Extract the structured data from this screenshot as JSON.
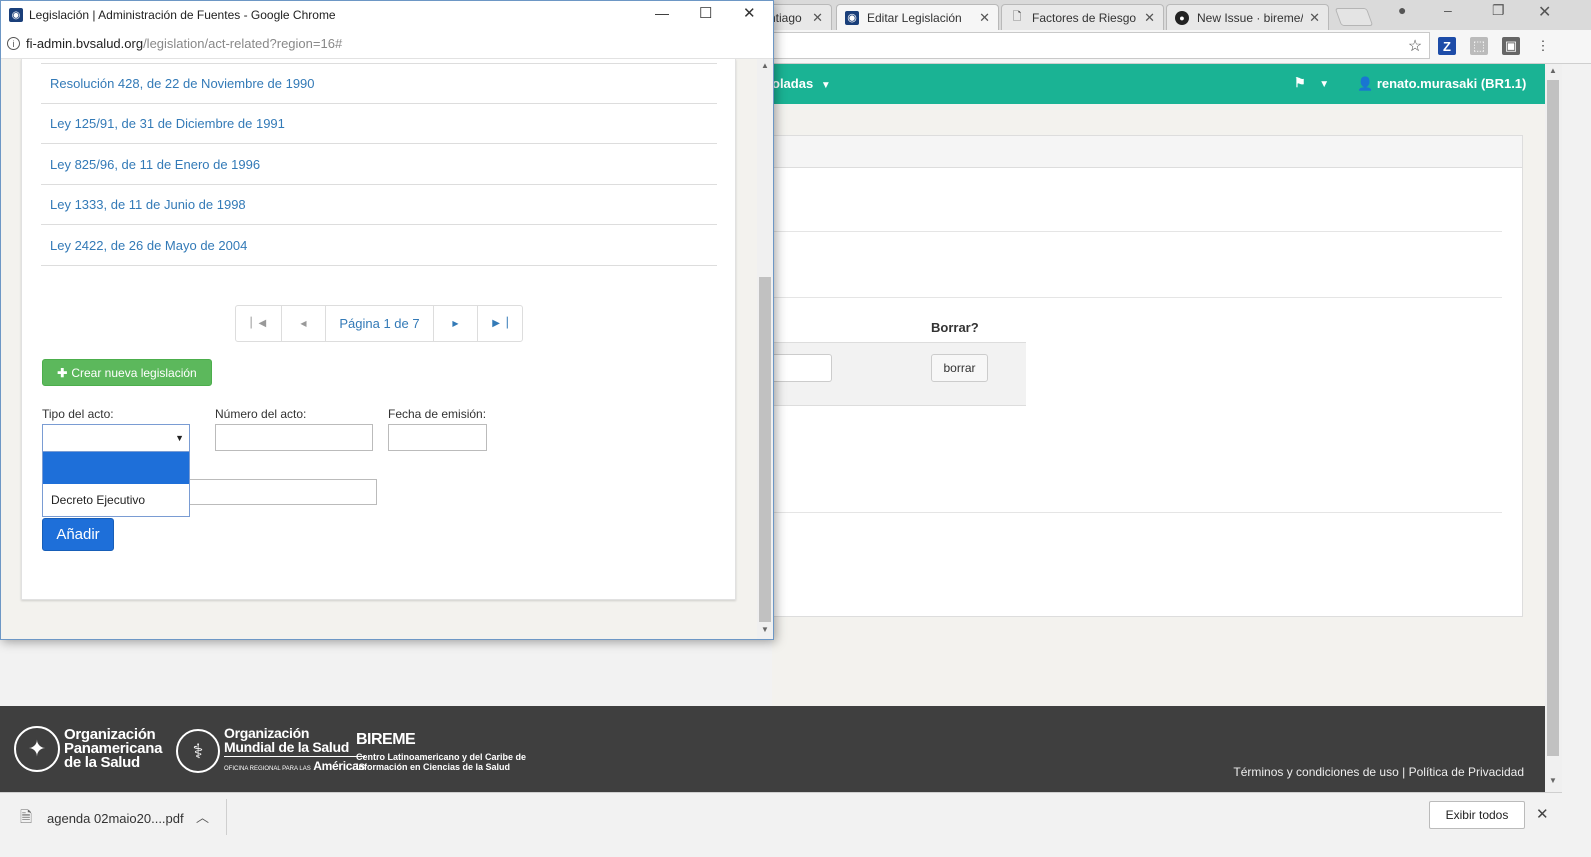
{
  "background_window": {
    "tabs": [
      {
        "title": "ntiago",
        "icon": "page-icon"
      },
      {
        "title": "Editar Legislación",
        "icon": "bireme-icon"
      },
      {
        "title": "Factores de Riesgo",
        "icon": "document-icon"
      },
      {
        "title": "New Issue · bireme/",
        "icon": "github-icon"
      }
    ],
    "navbar": {
      "menu_label": "oladas",
      "user_label": "renato.murasaki (BR1.1)"
    },
    "table": {
      "delete_header": "Borrar?",
      "delete_button": "borrar"
    },
    "footer": {
      "paho_name": "Organización Panamericana de la Salud",
      "paho_line1": "Organización",
      "paho_line2": "Panamericana",
      "paho_line3": "de la Salud",
      "who_line1": "Organización",
      "who_line2": "Mundial de la Salud",
      "who_regional": "OFICINA REGIONAL PARA LAS",
      "who_region": "Américas",
      "bireme_title": "BIREME",
      "bireme_line1": "Centro Latinoamericano y del Caribe de",
      "bireme_line2": "Información en Ciencias de la Salud",
      "terms": "Términos y condiciones de uso",
      "separator": "|",
      "privacy": "Política de Privacidad"
    },
    "download_bar": {
      "filename": "agenda 02maio20....pdf",
      "show_all": "Exibir todos"
    }
  },
  "popup": {
    "window_title": "Legislación | Administración de Fuentes - Google Chrome",
    "url_host": "fi-admin.bvsalud.org",
    "url_path": "/legislation/act-related?region=16#",
    "laws": [
      "Resolución 428, de 22 de Noviembre de 1990",
      "Ley 125/91, de 31 de Diciembre de 1991",
      "Ley 825/96, de 11 de Enero de 1996",
      "Ley 1333, de 11 de Junio de 1998",
      "Ley 2422, de 26 de Mayo de 2004"
    ],
    "pagination": {
      "page_label": "Página 1 de 7"
    },
    "create_button": "Crear nueva legislación",
    "form": {
      "type_label": "Tipo del acto:",
      "number_label": "Número del acto:",
      "date_label": "Fecha de emisión:",
      "type_options": [
        "",
        "Decreto Ejecutivo"
      ],
      "add_button": "Añadir"
    }
  },
  "colors": {
    "navbar_green": "#1ab394",
    "link_blue": "#337ab7",
    "button_green": "#5cb85c",
    "button_blue": "#1e6fd9",
    "footer_dark": "#3f3f3f"
  }
}
